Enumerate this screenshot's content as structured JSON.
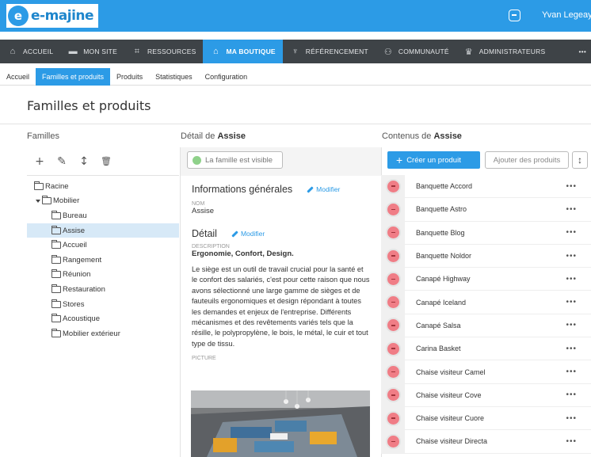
{
  "app": {
    "logo_mark": "e",
    "logo_text": "e-majine",
    "user_name": "Yvan Legeay"
  },
  "main_nav": [
    {
      "label": "ACCUEIL",
      "icon": "home-icon",
      "glyph": "⌂",
      "active": false
    },
    {
      "label": "MON SITE",
      "icon": "monitor-icon",
      "glyph": "▬",
      "active": false
    },
    {
      "label": "RESSOURCES",
      "icon": "crop-icon",
      "glyph": "⌗",
      "active": false
    },
    {
      "label": "MA BOUTIQUE",
      "icon": "shop-icon",
      "glyph": "⌂",
      "active": true
    },
    {
      "label": "RÉFÉRENCEMENT",
      "icon": "trophy-icon",
      "glyph": "♆",
      "active": false
    },
    {
      "label": "COMMUNAUTÉ",
      "icon": "users-icon",
      "glyph": "⚇",
      "active": false
    },
    {
      "label": "ADMINISTRATEURS",
      "icon": "crown-icon",
      "glyph": "♛",
      "active": false
    }
  ],
  "nav_more": "•••",
  "sub_nav": [
    {
      "label": "Accueil",
      "active": false
    },
    {
      "label": "Familles et produits",
      "active": true
    },
    {
      "label": "Produits",
      "active": false
    },
    {
      "label": "Statistiques",
      "active": false
    },
    {
      "label": "Configuration",
      "active": false
    }
  ],
  "page_title": "Familles et produits",
  "columns": {
    "families": "Familles",
    "detail_prefix": "Détail de",
    "detail_name": "Assise",
    "contents_prefix": "Contenus de",
    "contents_name": "Assise"
  },
  "family_tools": {
    "add": "+",
    "edit": "✎",
    "sort": "↕",
    "delete": "🗑"
  },
  "tree": [
    {
      "label": "Racine",
      "level": 0,
      "expanded": false,
      "selected": false
    },
    {
      "label": "Mobilier",
      "level": 0,
      "expanded": true,
      "selected": false
    },
    {
      "label": "Bureau",
      "level": 1,
      "expanded": false,
      "selected": false
    },
    {
      "label": "Assise",
      "level": 1,
      "expanded": false,
      "selected": true
    },
    {
      "label": "Accueil",
      "level": 1,
      "expanded": false,
      "selected": false
    },
    {
      "label": "Rangement",
      "level": 1,
      "expanded": false,
      "selected": false
    },
    {
      "label": "Réunion",
      "level": 1,
      "expanded": false,
      "selected": false
    },
    {
      "label": "Restauration",
      "level": 1,
      "expanded": false,
      "selected": false
    },
    {
      "label": "Stores",
      "level": 1,
      "expanded": false,
      "selected": false
    },
    {
      "label": "Acoustique",
      "level": 1,
      "expanded": false,
      "selected": false
    },
    {
      "label": "Mobilier extérieur",
      "level": 1,
      "expanded": false,
      "selected": false
    }
  ],
  "detail": {
    "visible_label": "La famille est visible",
    "general_title": "Informations générales",
    "modify_label": "Modifier",
    "name_label": "NOM",
    "name_value": "Assise",
    "detail_title": "Détail",
    "description_label": "DESCRIPTION",
    "description_bold": "Ergonomie, Confort, Design.",
    "description_text": "Le siège est un outil de travail crucial pour la santé et le confort des salariés, c'est pour cette raison que nous avons sélectionné une large gamme de sièges et de fauteuils ergonomiques et design répondant à toutes les demandes et enjeux de l'entreprise. Différents mécanismes et des revêtements variés tels que la résille, le polypropylène, le bois, le métal, le cuir et tout type de tissu.",
    "picture_label": "PICTURE"
  },
  "contents": {
    "create_label": "Créer un produit",
    "add_label": "Ajouter des produits",
    "sort_glyph": "↕",
    "row_menu": "•••",
    "products": [
      "Banquette Accord",
      "Banquette Astro",
      "Banquette Blog",
      "Banquette Noldor",
      "Canapé Highway",
      "Canapé Iceland",
      "Canapé Salsa",
      "Carina Basket",
      "Chaise visiteur Camel",
      "Chaise visiteur Cove",
      "Chaise visiteur Cuore",
      "Chaise visiteur Directa"
    ]
  },
  "colors": {
    "accent": "#2c9be6",
    "nav_dark": "#3e4347",
    "selected_row": "#d7e9f7",
    "visible_dot": "#8fd18a",
    "product_thumb": "#f07d86"
  }
}
